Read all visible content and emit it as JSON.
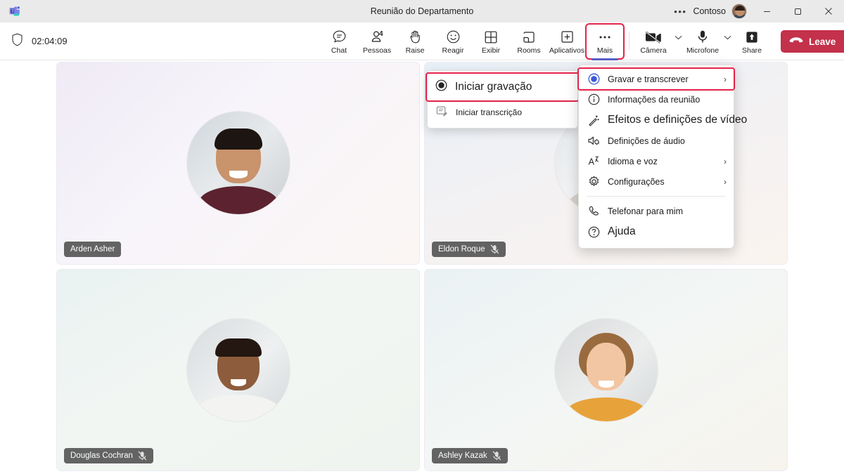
{
  "titlebar": {
    "logo_icon": "teams-logo-icon",
    "title": "Reunião do Departamento",
    "overflow_icon": "ellipsis-icon",
    "org": "Contoso",
    "avatar_icon": "user-avatar",
    "minimize_icon": "minimize-icon",
    "maximize_icon": "maximize-icon",
    "close_icon": "close-icon"
  },
  "controlbar": {
    "shield_icon": "shield-icon",
    "timer": "02:04:09",
    "buttons": [
      {
        "label": "Chat",
        "icon": "chat-icon"
      },
      {
        "label": "Pessoas",
        "icon": "people-icon",
        "badge": "4"
      },
      {
        "label": "Raise",
        "icon": "raise-hand-icon"
      },
      {
        "label": "Reagir",
        "icon": "smiley-icon"
      },
      {
        "label": "Exibir",
        "icon": "grid-view-icon"
      },
      {
        "label": "Rooms",
        "icon": "breakout-rooms-icon"
      },
      {
        "label": "Aplicativos",
        "icon": "apps-plus-icon"
      },
      {
        "label": "Mais",
        "icon": "ellipsis-icon",
        "highlighted": true
      }
    ],
    "camera": {
      "label": "Câmera",
      "icon": "camera-off-icon",
      "chevron": "chevron-down-icon"
    },
    "microphone": {
      "label": "Microfone",
      "icon": "microphone-icon",
      "chevron": "chevron-down-icon"
    },
    "share": {
      "label": "Share",
      "icon": "share-screen-icon"
    },
    "leave": {
      "label": "Leave",
      "icon": "hang-up-icon",
      "chevron": "chevron-down-icon",
      "color": "#c4314b"
    }
  },
  "stage": {
    "tiles": [
      {
        "name": "Arden Asher",
        "muted": false,
        "mute_icon": ""
      },
      {
        "name": "Eldon Roque",
        "muted": true,
        "mute_icon": "mic-off-icon"
      },
      {
        "name": "Douglas Cochran",
        "muted": true,
        "mute_icon": "mic-off-icon"
      },
      {
        "name": "Ashley Kazak",
        "muted": true,
        "mute_icon": "mic-off-icon"
      }
    ]
  },
  "submenu": {
    "items": [
      {
        "label": "Iniciar gravação",
        "icon": "record-circle-icon",
        "highlighted": true
      },
      {
        "label": "Iniciar transcrição",
        "icon": "transcript-icon",
        "highlighted": false
      }
    ]
  },
  "menu": {
    "items": [
      {
        "label": "Gravar e transcrever",
        "icon": "record-circle-icon",
        "arrow": "›",
        "highlighted": true
      },
      {
        "label": "Informações da reunião",
        "icon": "info-icon",
        "arrow": ""
      },
      {
        "label": "Efeitos e definições de vídeo",
        "icon": "video-effects-icon",
        "arrow": ""
      },
      {
        "label": "Definições de áudio",
        "icon": "audio-settings-icon",
        "arrow": ""
      },
      {
        "label": "Idioma e voz",
        "icon": "language-icon",
        "arrow": "›"
      },
      {
        "label": "Configurações",
        "icon": "gear-icon",
        "arrow": "›"
      },
      {
        "label": "Telefonar para mim",
        "icon": "phone-icon",
        "arrow": ""
      },
      {
        "label": "Ajuda",
        "icon": "help-icon",
        "arrow": ""
      }
    ]
  },
  "colors": {
    "highlight": "#e3234a",
    "accent": "#5b5fc7",
    "leave": "#c4314b"
  }
}
